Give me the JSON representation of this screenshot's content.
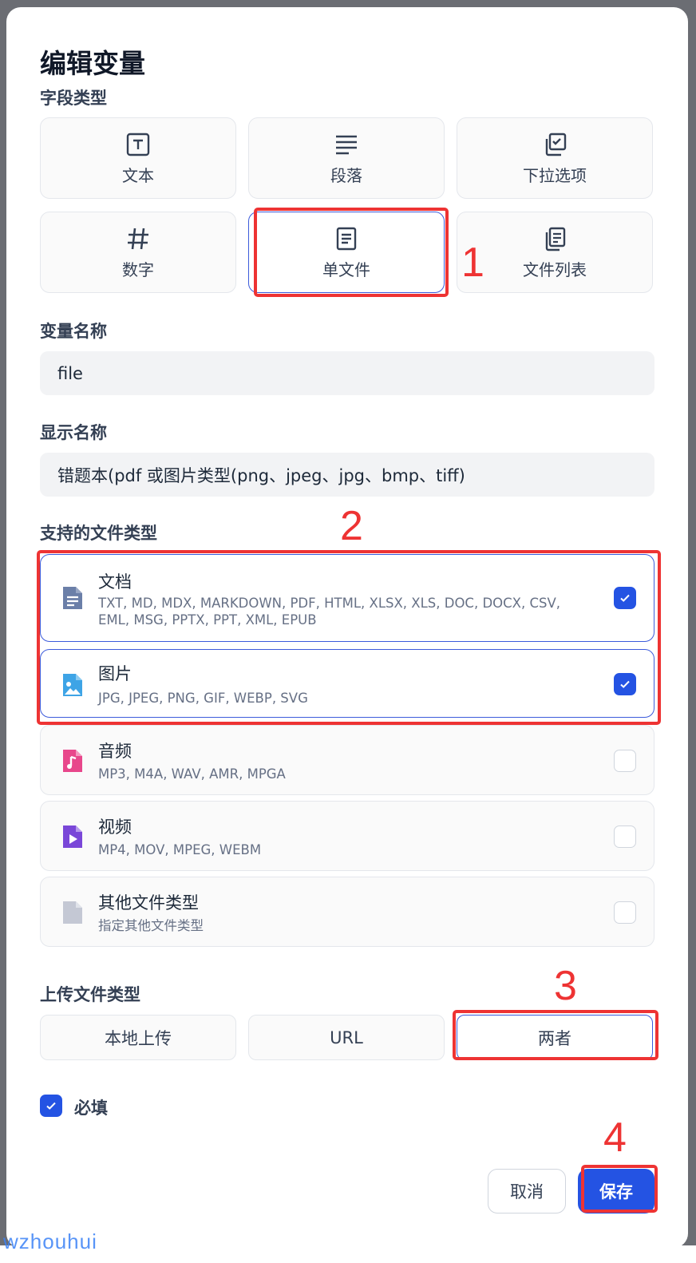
{
  "dialog": {
    "title": "编辑变量"
  },
  "field_type": {
    "label": "字段类型",
    "options": [
      {
        "label": "文本",
        "icon": "text-box-icon"
      },
      {
        "label": "段落",
        "icon": "paragraph-lines-icon"
      },
      {
        "label": "下拉选项",
        "icon": "dropdown-options-icon"
      },
      {
        "label": "数字",
        "icon": "hash-icon"
      },
      {
        "label": "单文件",
        "icon": "file-icon",
        "selected": true
      },
      {
        "label": "文件列表",
        "icon": "file-list-icon"
      }
    ]
  },
  "variable_name": {
    "label": "变量名称",
    "value": "file"
  },
  "display_name": {
    "label": "显示名称",
    "value": "错题本(pdf 或图片类型(png、jpeg、jpg、bmp、tiff)"
  },
  "file_types": {
    "label": "支持的文件类型",
    "items": [
      {
        "name": "文档",
        "desc": "TXT, MD, MDX, MARKDOWN, PDF, HTML, XLSX, XLS, DOC, DOCX, CSV, EML, MSG, PPTX, PPT, XML, EPUB",
        "checked": true,
        "color": "#6b7fa8"
      },
      {
        "name": "图片",
        "desc": "JPG, JPEG, PNG, GIF, WEBP, SVG",
        "checked": true,
        "color": "#3ea4e6"
      },
      {
        "name": "音频",
        "desc": "MP3, M4A, WAV, AMR, MPGA",
        "checked": false,
        "color": "#e8478b"
      },
      {
        "name": "视频",
        "desc": "MP4, MOV, MPEG, WEBM",
        "checked": false,
        "color": "#7a47d8"
      },
      {
        "name": "其他文件类型",
        "desc": "指定其他文件类型",
        "checked": false,
        "color": "#c4c8d4"
      }
    ]
  },
  "upload_type": {
    "label": "上传文件类型",
    "options": [
      {
        "label": "本地上传"
      },
      {
        "label": "URL"
      },
      {
        "label": "两者",
        "selected": true
      }
    ]
  },
  "required": {
    "label": "必填",
    "checked": true
  },
  "footer": {
    "cancel_label": "取消",
    "save_label": "保存"
  },
  "annotations": [
    "1",
    "2",
    "3",
    "4"
  ],
  "watermark": "wzhouhui",
  "colors": {
    "accent": "#2453e3",
    "annotation": "#ee3333"
  }
}
